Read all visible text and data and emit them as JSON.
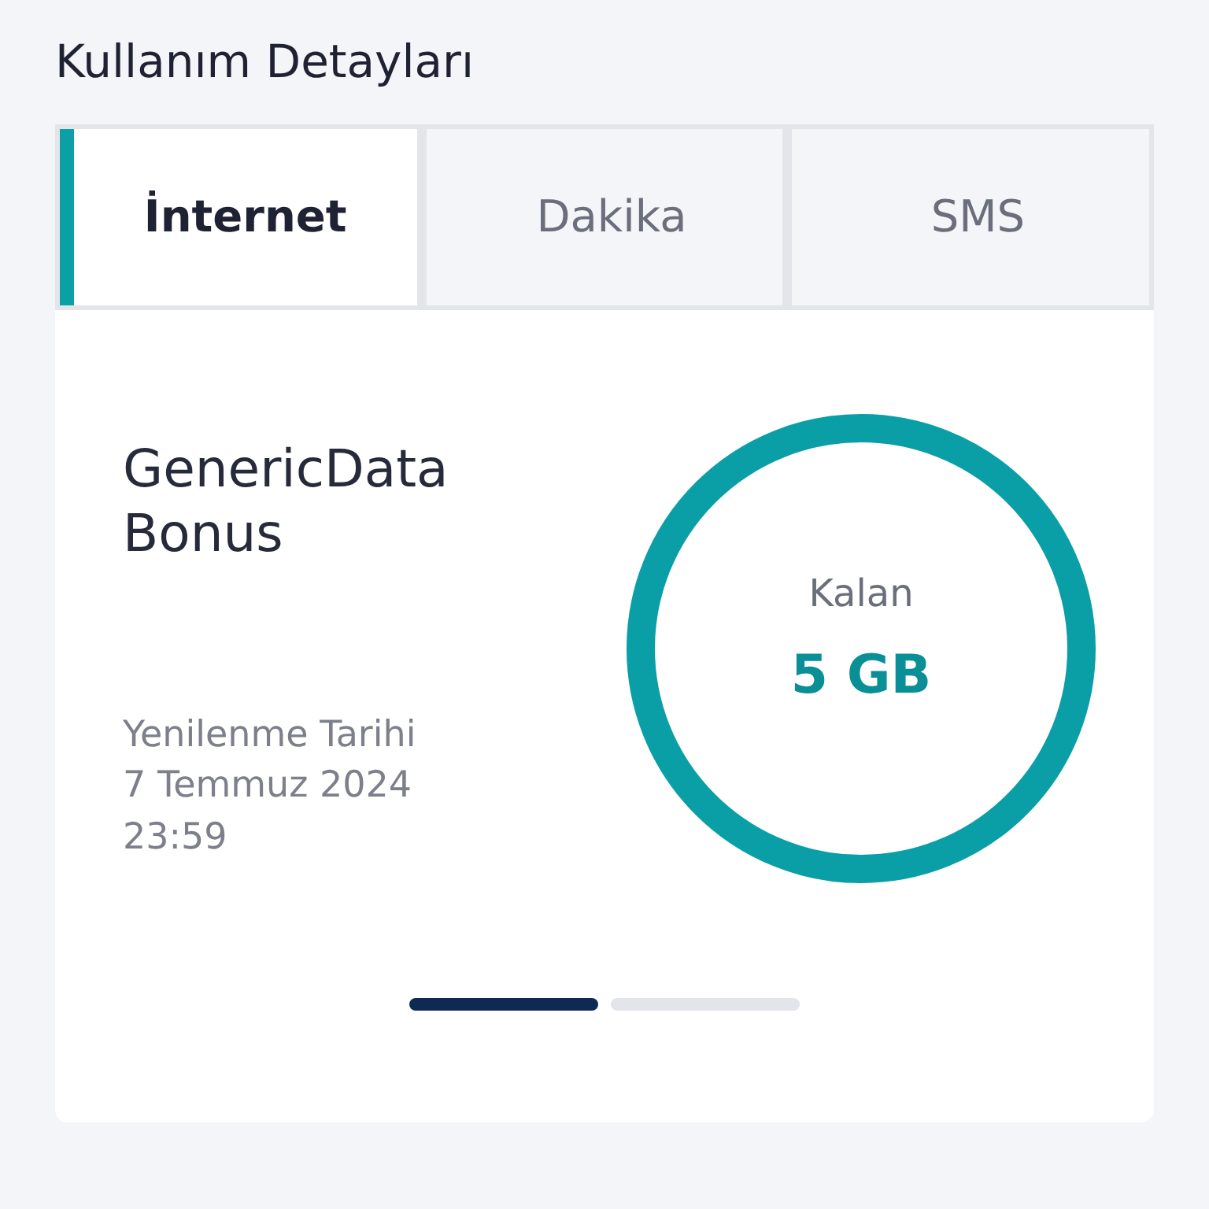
{
  "title": "Kullanım Detayları",
  "tabs": [
    {
      "label": "İnternet",
      "selected": true
    },
    {
      "label": "Dakika",
      "selected": false
    },
    {
      "label": "SMS",
      "selected": false
    }
  ],
  "package": {
    "name": "GenericData Bonus",
    "renewal_label": "Yenilenme Tarihi",
    "renewal_date": "7 Temmuz 2024",
    "renewal_time": "23:59"
  },
  "gauge": {
    "label": "Kalan",
    "value": "5 GB",
    "level": 1
  },
  "pager": [
    {
      "selected": true
    },
    {
      "selected": false
    }
  ]
}
